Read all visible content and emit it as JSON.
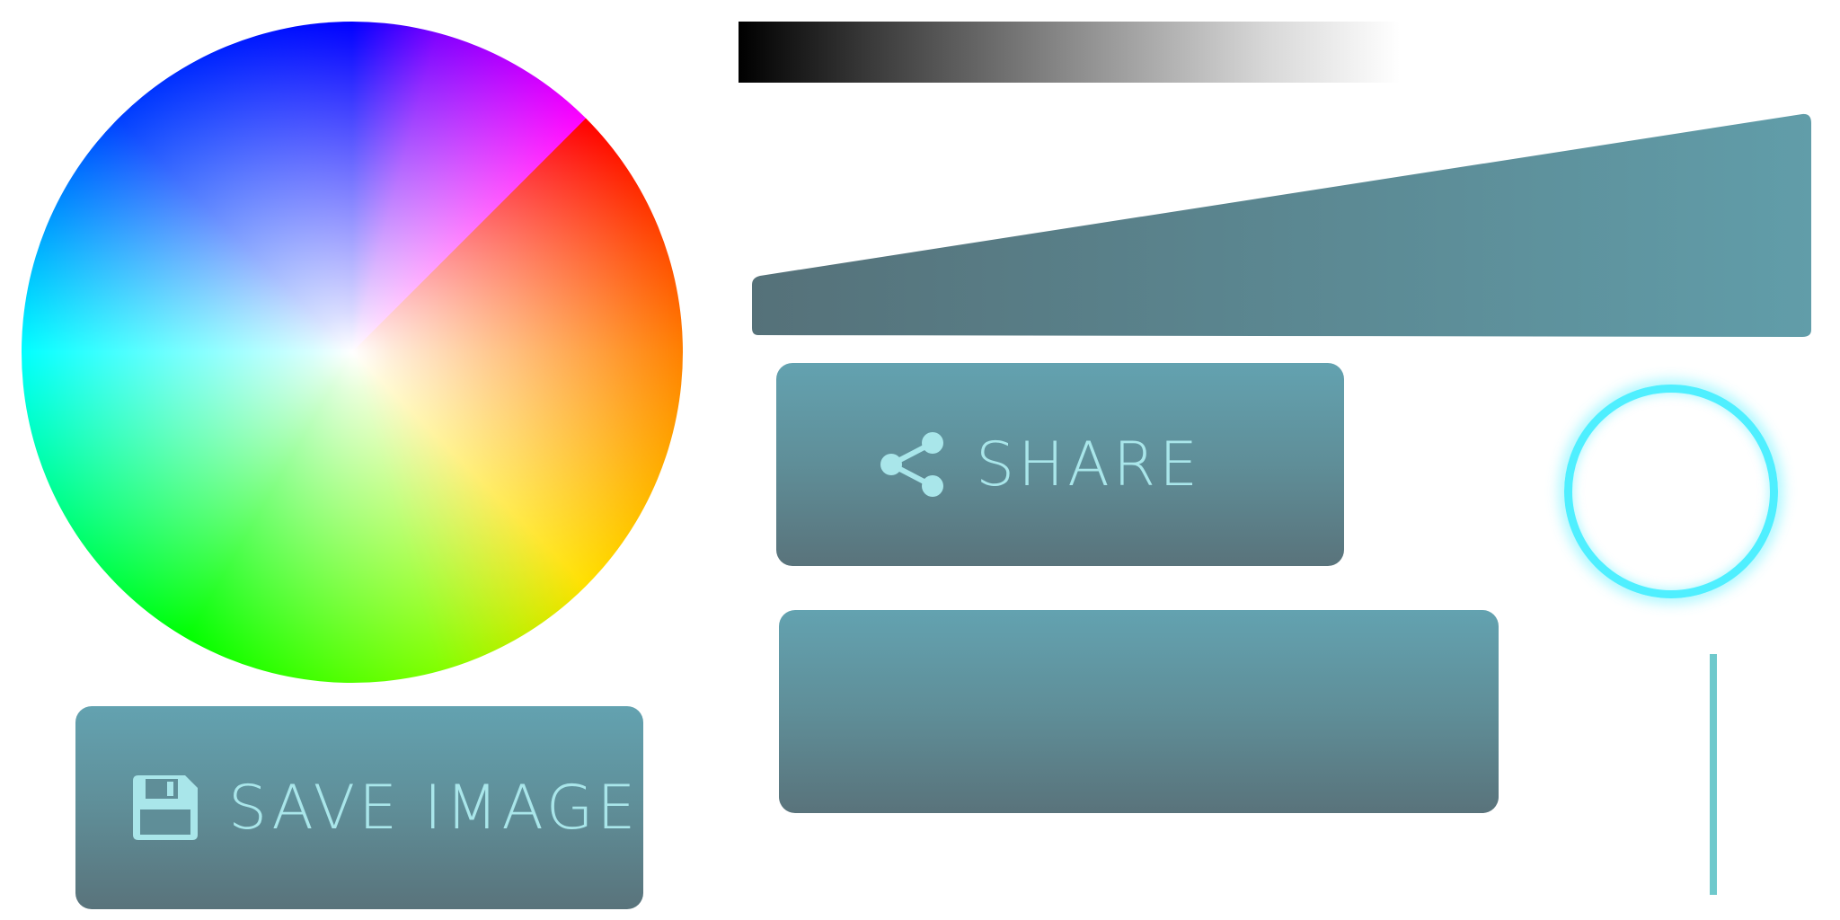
{
  "colors": {
    "button_gradient_top": "#63a2b0",
    "button_gradient_bottom": "#59737b",
    "button_text": "#a9e6ea",
    "wedge_left": "#557179",
    "wedge_right": "#619da9",
    "glow_ring": "#4fefff",
    "vertical_slider": "#6ec9cc"
  },
  "share_button": {
    "label": "SHARE",
    "icon": "share-icon"
  },
  "save_button": {
    "label": "SAVE IMAGE",
    "icon": "floppy-disk-icon"
  },
  "blank_button": {
    "label": ""
  }
}
